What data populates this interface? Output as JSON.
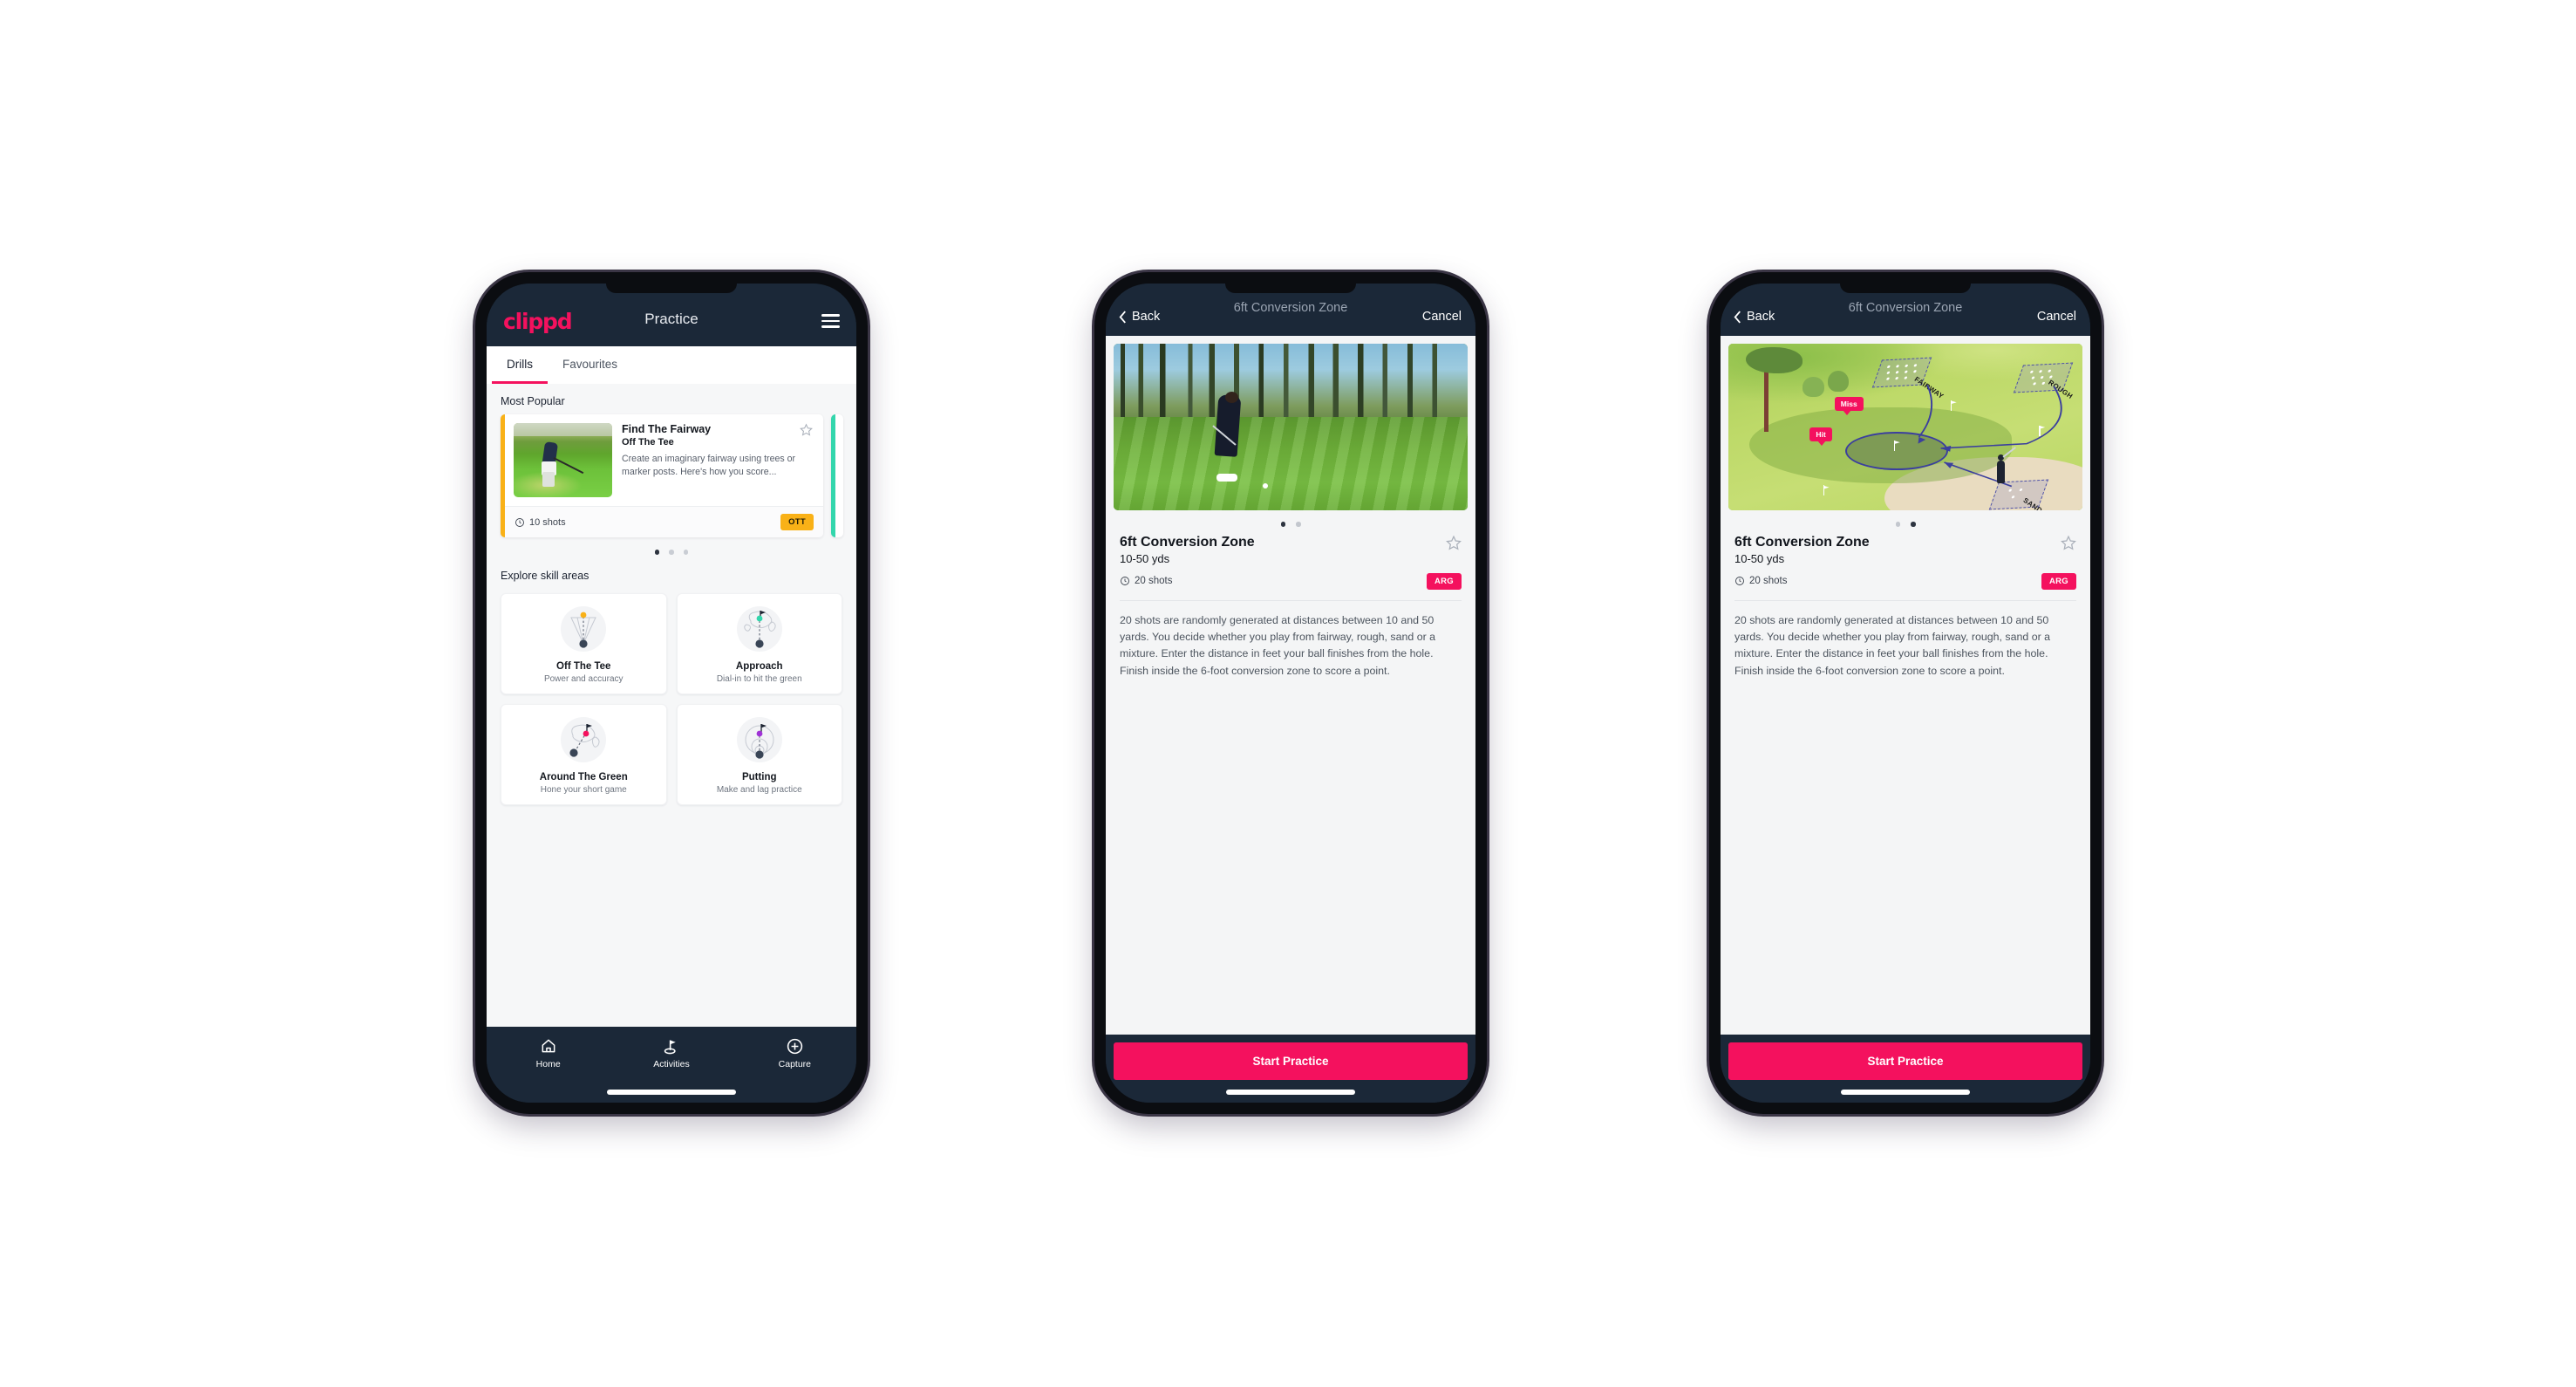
{
  "phone1": {
    "name": "practice-screen",
    "topbar": {
      "logo": "clippd",
      "title": "Practice",
      "menu_icon": "hamburger-icon"
    },
    "tabs": [
      {
        "label": "Drills",
        "active": true
      },
      {
        "label": "Favourites",
        "active": false
      }
    ],
    "most_popular": {
      "section_title": "Most Popular",
      "card": {
        "title": "Find The Fairway",
        "subtitle": "Off The Tee",
        "description": "Create an imaginary fairway using trees or marker posts. Here's how you score...",
        "shots": "10 shots",
        "badge": "OTT",
        "badge_color": "#f9b117",
        "accent_color": "#f9b117",
        "star_icon": "star-outline-icon",
        "clock_icon": "clock-icon"
      },
      "dots": [
        true,
        false,
        false
      ]
    },
    "explore": {
      "section_title": "Explore skill areas",
      "cards": [
        {
          "name": "Off The Tee",
          "desc": "Power and accuracy",
          "icon": "tee-dispersion-icon",
          "dot_color": "#f9b117"
        },
        {
          "name": "Approach",
          "desc": "Dial-in to hit the green",
          "icon": "approach-green-icon",
          "dot_color": "#33d6ac"
        },
        {
          "name": "Around The Green",
          "desc": "Hone your short game",
          "icon": "chip-green-icon",
          "dot_color": "#f4115e"
        },
        {
          "name": "Putting",
          "desc": "Make and lag practice",
          "icon": "putting-rings-icon",
          "dot_color": "#a033d6"
        }
      ]
    },
    "bottomnav": [
      {
        "label": "Home",
        "icon": "home-icon",
        "active": false
      },
      {
        "label": "Activities",
        "icon": "golf-flag-icon",
        "active": true
      },
      {
        "label": "Capture",
        "icon": "plus-circle-icon",
        "active": false
      }
    ]
  },
  "phone2": {
    "name": "drill-detail-slide-1",
    "navbar": {
      "back": "Back",
      "title": "6ft Conversion Zone",
      "cancel": "Cancel",
      "back_icon": "chevron-left-icon"
    },
    "media": {
      "type": "photo",
      "alt": "golfer-chipping-photo"
    },
    "dots": [
      true,
      false
    ],
    "detail": {
      "title": "6ft Conversion Zone",
      "subtitle": "10-50 yds",
      "shots": "20 shots",
      "badge": "ARG",
      "badge_color": "#f4115e",
      "star_icon": "star-outline-icon",
      "clock_icon": "clock-icon",
      "description": "20 shots are randomly generated at distances between 10 and 50 yards. You decide whether you play from fairway, rough, sand or a mixture. Enter the distance in feet your ball finishes from the hole. Finish inside the 6-foot conversion zone to score a point."
    },
    "cta": "Start Practice"
  },
  "phone3": {
    "name": "drill-detail-slide-2",
    "navbar": {
      "back": "Back",
      "title": "6ft Conversion Zone",
      "cancel": "Cancel",
      "back_icon": "chevron-left-icon"
    },
    "media": {
      "type": "illustration",
      "alt": "golf-hole-diagram",
      "labels": {
        "fairway": "FAIRWAY",
        "rough": "ROUGH",
        "sand": "SAND",
        "miss": "Miss",
        "hit": "Hit"
      }
    },
    "dots": [
      false,
      true
    ],
    "detail": {
      "title": "6ft Conversion Zone",
      "subtitle": "10-50 yds",
      "shots": "20 shots",
      "badge": "ARG",
      "badge_color": "#f4115e",
      "star_icon": "star-outline-icon",
      "clock_icon": "clock-icon",
      "description": "20 shots are randomly generated at distances between 10 and 50 yards. You decide whether you play from fairway, rough, sand or a mixture. Enter the distance in feet your ball finishes from the hole. Finish inside the 6-foot conversion zone to score a point."
    },
    "cta": "Start Practice"
  }
}
